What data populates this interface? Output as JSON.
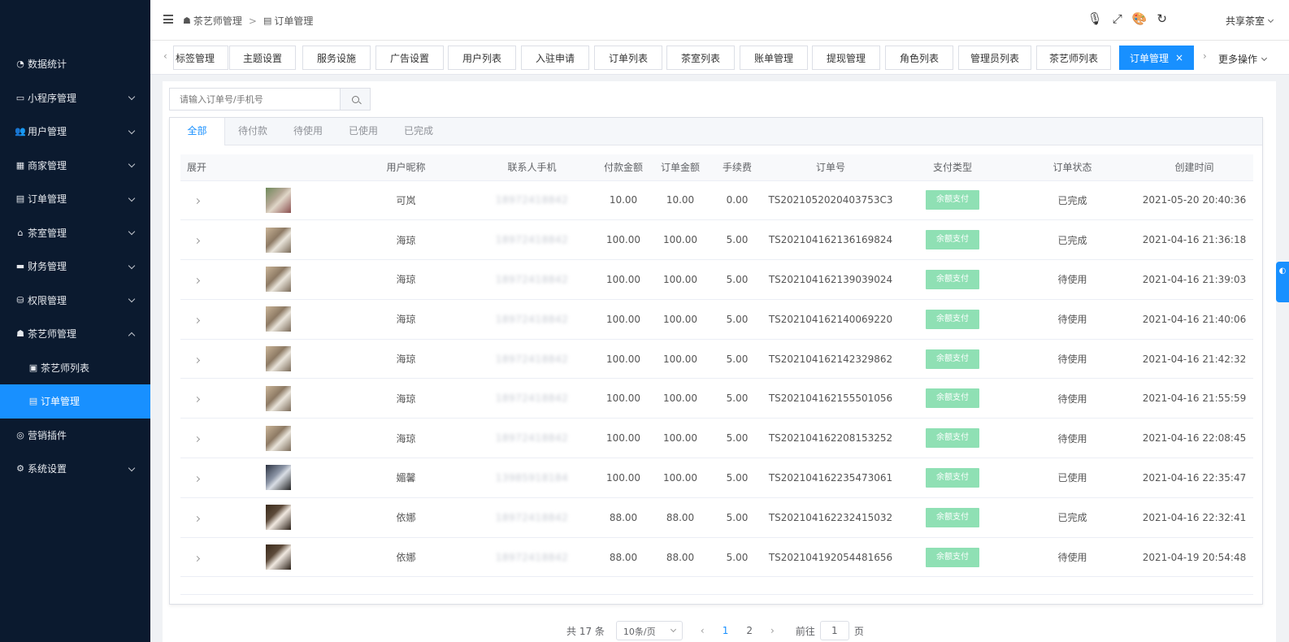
{
  "header": {
    "breadcrumb": [
      "茶艺师管理",
      "订单管理"
    ],
    "user_name": "共享茶室"
  },
  "sidebar": {
    "items": [
      {
        "label": "数据统计",
        "icon": "dashboard-icon",
        "has_children": false
      },
      {
        "label": "小程序管理",
        "icon": "monitor-icon",
        "has_children": true
      },
      {
        "label": "用户管理",
        "icon": "users-icon",
        "has_children": true
      },
      {
        "label": "商家管理",
        "icon": "building-icon",
        "has_children": true
      },
      {
        "label": "订单管理",
        "icon": "clipboard-icon",
        "has_children": true
      },
      {
        "label": "茶室管理",
        "icon": "home-icon",
        "has_children": true
      },
      {
        "label": "财务管理",
        "icon": "money-icon",
        "has_children": true
      },
      {
        "label": "权限管理",
        "icon": "database-icon",
        "has_children": true
      },
      {
        "label": "茶艺师管理",
        "icon": "user-lock-icon",
        "has_children": true,
        "expanded": true
      },
      {
        "label": "茶艺师列表",
        "icon": "id-card-icon",
        "sub": true
      },
      {
        "label": "订单管理",
        "icon": "clipboard-icon",
        "sub": true,
        "active": true
      },
      {
        "label": "营销插件",
        "icon": "target-icon",
        "has_children": false
      },
      {
        "label": "系统设置",
        "icon": "gear-icon",
        "has_children": true
      }
    ]
  },
  "tags": {
    "items": [
      "标签管理",
      "主题设置",
      "服务设施",
      "广告设置",
      "用户列表",
      "入驻申请",
      "订单列表",
      "茶室列表",
      "账单管理",
      "提现管理",
      "角色列表",
      "管理员列表",
      "茶艺师列表",
      "订单管理"
    ],
    "more_label": "更多操作"
  },
  "search": {
    "placeholder": "请输入订单号/手机号"
  },
  "tabs": [
    "全部",
    "待付款",
    "待使用",
    "已使用",
    "已完成"
  ],
  "table": {
    "columns": [
      "展开",
      "",
      "用户昵称",
      "联系人手机",
      "付款金额",
      "订单金额",
      "手续费",
      "订单号",
      "支付类型",
      "订单状态",
      "创建时间"
    ],
    "rows": [
      {
        "nickname": "可岚",
        "phone": "18972418842",
        "paid": "10.00",
        "amount": "10.00",
        "fee": "0.00",
        "order_no": "TS2021052020403753C3",
        "pay_type": "余额支付",
        "status": "已完成",
        "created": "2021-05-20 20:40:36"
      },
      {
        "nickname": "海琼",
        "phone": "18972418842",
        "paid": "100.00",
        "amount": "100.00",
        "fee": "5.00",
        "order_no": "TS202104162136169824",
        "pay_type": "余额支付",
        "status": "已完成",
        "created": "2021-04-16 21:36:18"
      },
      {
        "nickname": "海琼",
        "phone": "18972418842",
        "paid": "100.00",
        "amount": "100.00",
        "fee": "5.00",
        "order_no": "TS202104162139039024",
        "pay_type": "余额支付",
        "status": "待使用",
        "created": "2021-04-16 21:39:03"
      },
      {
        "nickname": "海琼",
        "phone": "18972418842",
        "paid": "100.00",
        "amount": "100.00",
        "fee": "5.00",
        "order_no": "TS202104162140069220",
        "pay_type": "余额支付",
        "status": "待使用",
        "created": "2021-04-16 21:40:06"
      },
      {
        "nickname": "海琼",
        "phone": "18972418842",
        "paid": "100.00",
        "amount": "100.00",
        "fee": "5.00",
        "order_no": "TS202104162142329862",
        "pay_type": "余额支付",
        "status": "待使用",
        "created": "2021-04-16 21:42:32"
      },
      {
        "nickname": "海琼",
        "phone": "18972418842",
        "paid": "100.00",
        "amount": "100.00",
        "fee": "5.00",
        "order_no": "TS202104162155501056",
        "pay_type": "余额支付",
        "status": "待使用",
        "created": "2021-04-16 21:55:59"
      },
      {
        "nickname": "海琼",
        "phone": "18972418842",
        "paid": "100.00",
        "amount": "100.00",
        "fee": "5.00",
        "order_no": "TS202104162208153252",
        "pay_type": "余额支付",
        "status": "待使用",
        "created": "2021-04-16 22:08:45"
      },
      {
        "nickname": "媚馨",
        "phone": "13985918184",
        "paid": "100.00",
        "amount": "100.00",
        "fee": "5.00",
        "order_no": "TS202104162235473061",
        "pay_type": "余额支付",
        "status": "已使用",
        "created": "2021-04-16 22:35:47"
      },
      {
        "nickname": "依娜",
        "phone": "18972418842",
        "paid": "88.00",
        "amount": "88.00",
        "fee": "5.00",
        "order_no": "TS202104162232415032",
        "pay_type": "余额支付",
        "status": "已完成",
        "created": "2021-04-16 22:32:41"
      },
      {
        "nickname": "依娜",
        "phone": "18972418842",
        "paid": "88.00",
        "amount": "88.00",
        "fee": "5.00",
        "order_no": "TS202104192054481656",
        "pay_type": "余额支付",
        "status": "待使用",
        "created": "2021-04-19 20:54:48"
      }
    ]
  },
  "pagination": {
    "total": "共 17 条",
    "page_size": "10条/页",
    "pages": [
      "1",
      "2"
    ],
    "current": "1",
    "goto_prefix": "前往",
    "goto_value": "1",
    "goto_suffix": "页"
  },
  "colors": {
    "sidebar_bg": "#0b1a2f",
    "accent": "#1890ff",
    "pay_badge": "#8fe0b4"
  }
}
